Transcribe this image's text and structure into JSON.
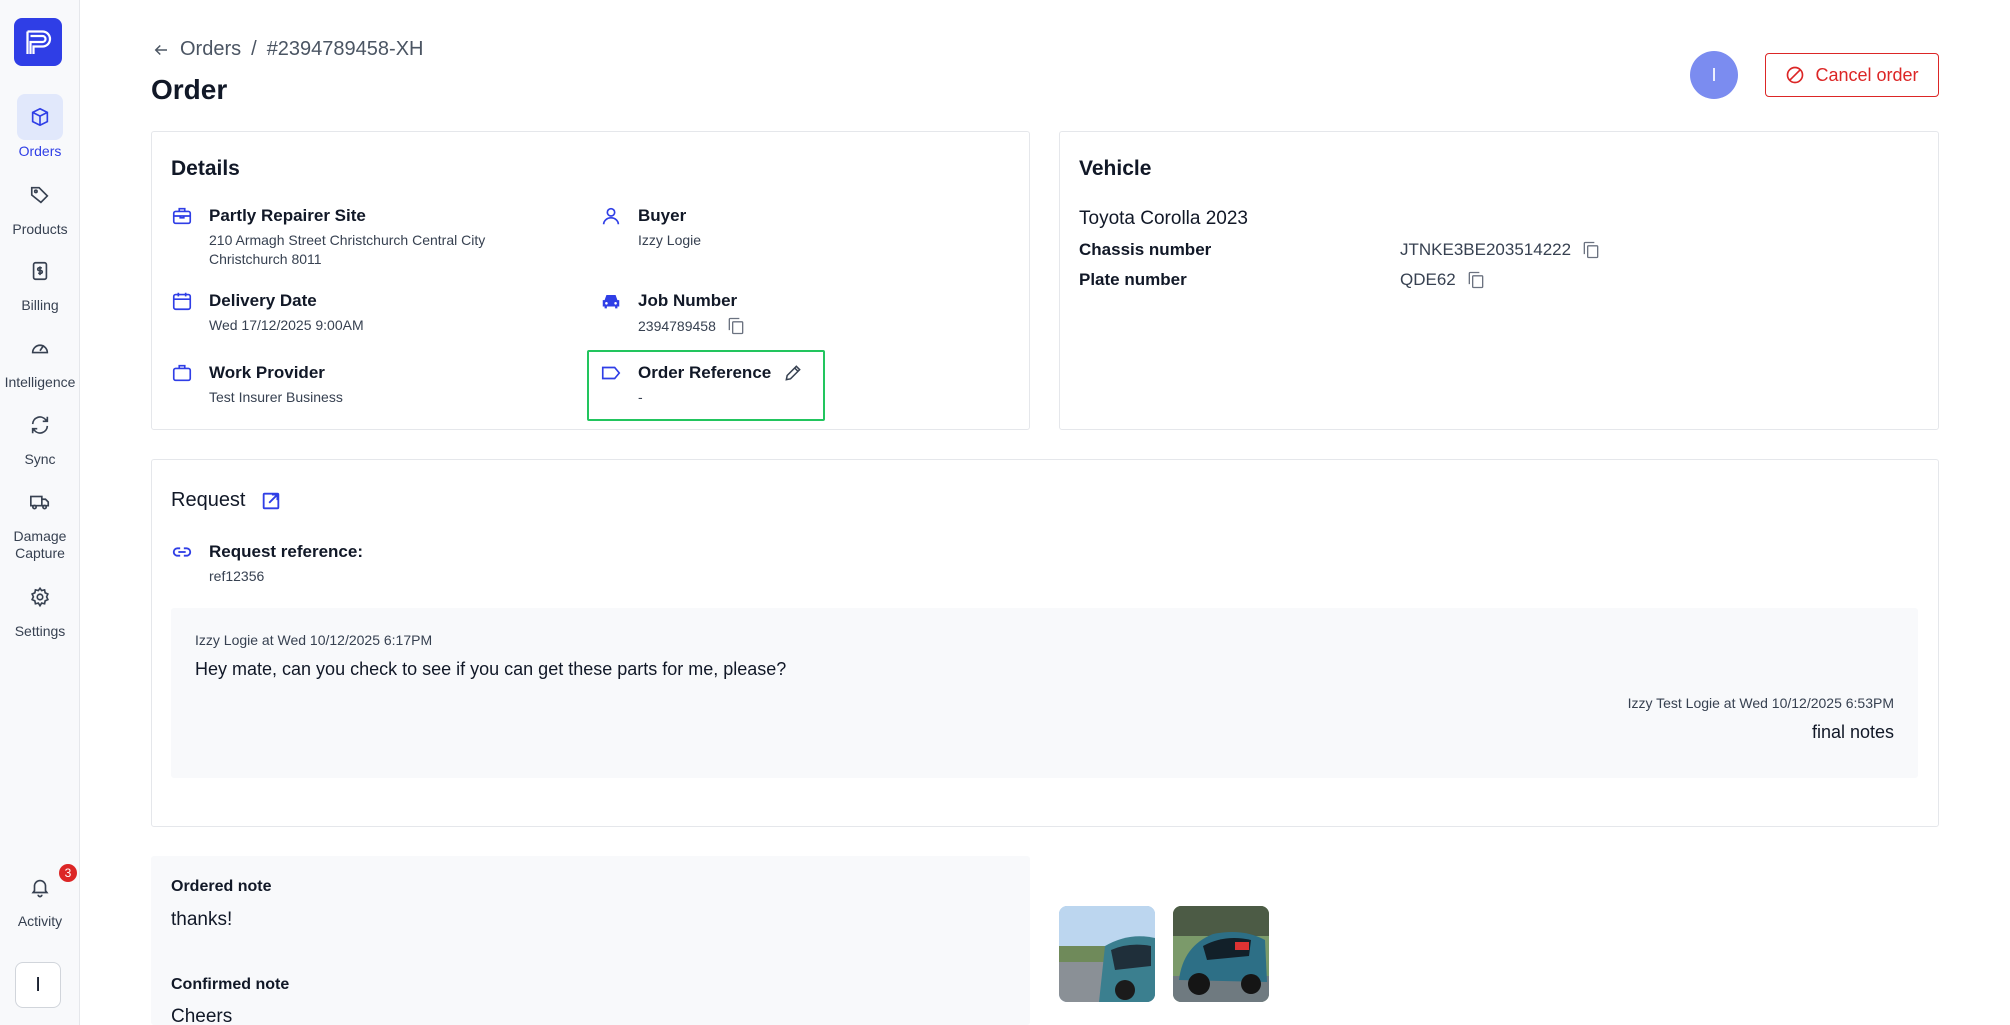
{
  "sidebar": {
    "items": [
      {
        "label": "Orders",
        "icon": "box-icon"
      },
      {
        "label": "Products",
        "icon": "tag-icon"
      },
      {
        "label": "Billing",
        "icon": "dollar-doc-icon"
      },
      {
        "label": "Intelligence",
        "icon": "gauge-icon"
      },
      {
        "label": "Sync",
        "icon": "sync-icon"
      },
      {
        "label": "Damage Capture",
        "icon": "truck-icon"
      },
      {
        "label": "Settings",
        "icon": "gear-icon"
      }
    ],
    "activity": {
      "label": "Activity",
      "badge": "3"
    },
    "user_initial": "I"
  },
  "header": {
    "breadcrumb_parent": "Orders",
    "breadcrumb_sep": "/",
    "breadcrumb_current": "#2394789458-XH",
    "title": "Order",
    "avatar_initial": "I",
    "cancel_label": "Cancel order"
  },
  "details": {
    "title": "Details",
    "site_label": "Partly Repairer Site",
    "site_address_1": "210 Armagh Street Christchurch Central City",
    "site_address_2": "Christchurch 8011",
    "buyer_label": "Buyer",
    "buyer_value": "Izzy Logie",
    "delivery_label": "Delivery Date",
    "delivery_value": "Wed 17/12/2025 9:00AM",
    "job_label": "Job Number",
    "job_value": "2394789458",
    "provider_label": "Work Provider",
    "provider_value": "Test Insurer Business",
    "ref_label": "Order Reference",
    "ref_value": "-"
  },
  "vehicle": {
    "title": "Vehicle",
    "name": "Toyota Corolla 2023",
    "chassis_label": "Chassis number",
    "chassis_value": "JTNKE3BE203514222",
    "plate_label": "Plate number",
    "plate_value": "QDE62"
  },
  "request": {
    "title": "Request",
    "ref_label": "Request reference:",
    "ref_value": "ref12356",
    "note1_meta": "Izzy Logie at Wed 10/12/2025 6:17PM",
    "note1_text": "Hey mate, can you check to see if you can get these parts for me, please?",
    "note2_meta": "Izzy Test Logie at Wed 10/12/2025 6:53PM",
    "note2_text": "final notes"
  },
  "notes": {
    "ordered_label": "Ordered note",
    "ordered_text": "thanks!",
    "confirmed_label": "Confirmed note",
    "confirmed_text": "Cheers"
  },
  "colors": {
    "accent": "#2f3ee6",
    "danger": "#dc2626",
    "highlight": "#22c55e"
  }
}
